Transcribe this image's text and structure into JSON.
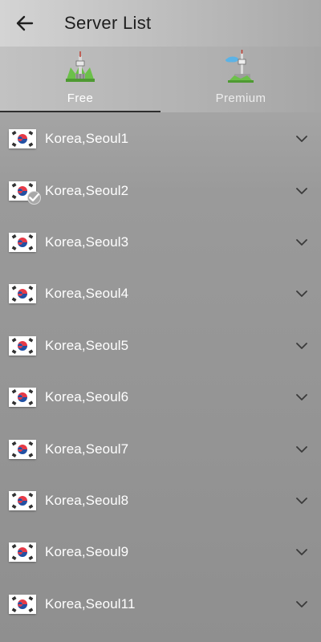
{
  "header": {
    "title": "Server List",
    "back_icon": "arrow-left-icon"
  },
  "tabs": [
    {
      "label": "Free",
      "icon": "seoul-tower-green-icon",
      "active": true
    },
    {
      "label": "Premium",
      "icon": "seoul-tower-sky-icon",
      "active": false
    }
  ],
  "servers": [
    {
      "name": "Korea,Seoul1",
      "flag": "south-korea-flag-icon",
      "selected": false
    },
    {
      "name": "Korea,Seoul2",
      "flag": "south-korea-flag-icon",
      "selected": true
    },
    {
      "name": "Korea,Seoul3",
      "flag": "south-korea-flag-icon",
      "selected": false
    },
    {
      "name": "Korea,Seoul4",
      "flag": "south-korea-flag-icon",
      "selected": false
    },
    {
      "name": "Korea,Seoul5",
      "flag": "south-korea-flag-icon",
      "selected": false
    },
    {
      "name": "Korea,Seoul6",
      "flag": "south-korea-flag-icon",
      "selected": false
    },
    {
      "name": "Korea,Seoul7",
      "flag": "south-korea-flag-icon",
      "selected": false
    },
    {
      "name": "Korea,Seoul8",
      "flag": "south-korea-flag-icon",
      "selected": false
    },
    {
      "name": "Korea,Seoul9",
      "flag": "south-korea-flag-icon",
      "selected": false
    },
    {
      "name": "Korea,Seoul11",
      "flag": "south-korea-flag-icon",
      "selected": false
    }
  ],
  "colors": {
    "flag_red": "#e63946",
    "flag_blue": "#1f4fa3",
    "indicator": "#2e2e2e",
    "tower_green": "#6cc04a"
  }
}
